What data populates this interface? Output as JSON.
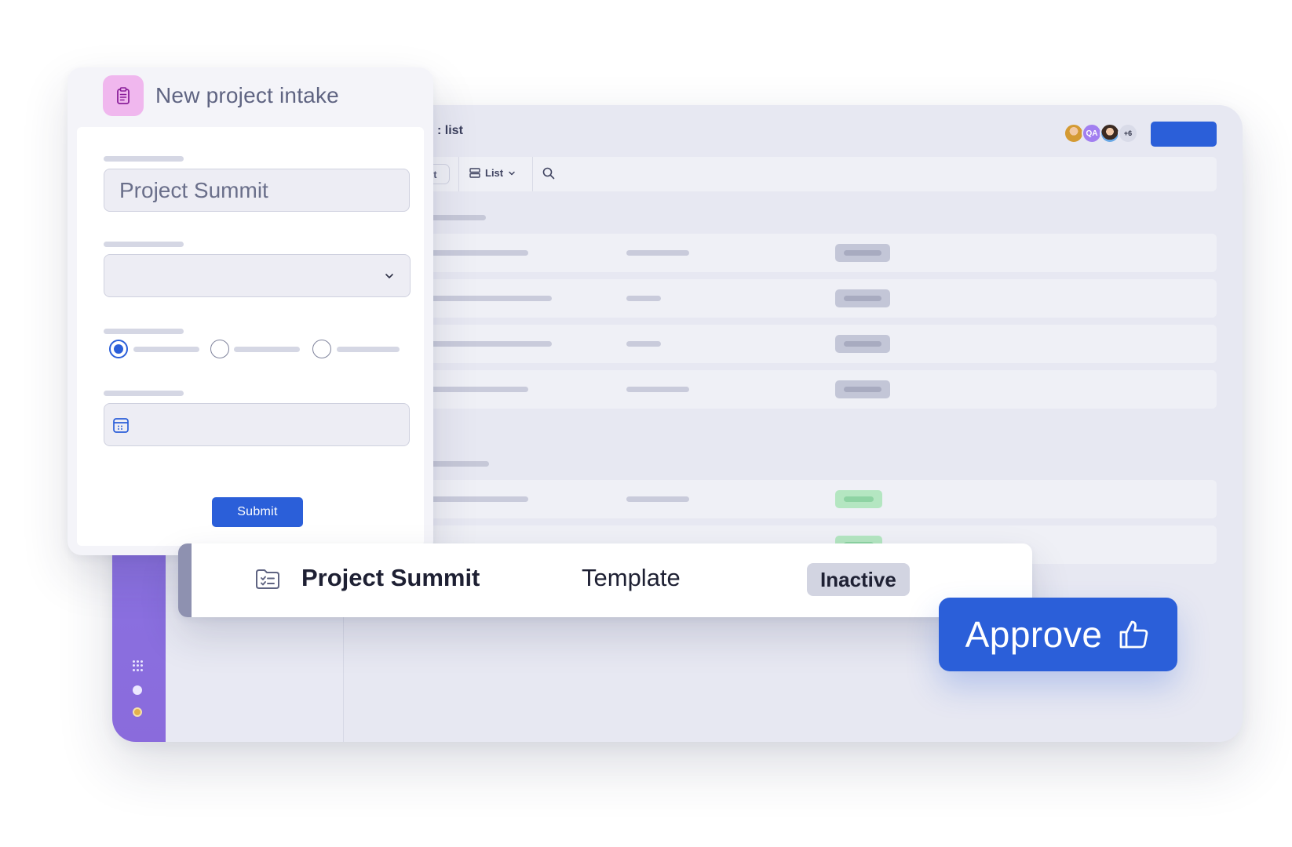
{
  "list_view": {
    "title": ": list",
    "avatars": [
      "QA",
      "+6"
    ],
    "toolbar": {
      "chip_partial_label": "ct",
      "view_label": "List"
    }
  },
  "intake_form": {
    "title": "New project intake",
    "project_name_value": "Project Summit",
    "submit_label": "Submit"
  },
  "project_row": {
    "name": "Project Summit",
    "type": "Template",
    "status": "Inactive"
  },
  "approve_button": {
    "label": "Approve"
  },
  "colors": {
    "primary": "#2b5fd9",
    "rail": "#8a73e2",
    "form_icon_bg": "#f0b7ee",
    "status_active": "#b4e6c1",
    "status_inactive": "#d2d4e1"
  },
  "icons": {
    "form_header": "clipboard-icon",
    "view_toggle": "list-icon",
    "search": "search-icon",
    "date": "calendar-icon",
    "project": "folder-checklist-icon",
    "approve": "thumbs-up-icon"
  }
}
